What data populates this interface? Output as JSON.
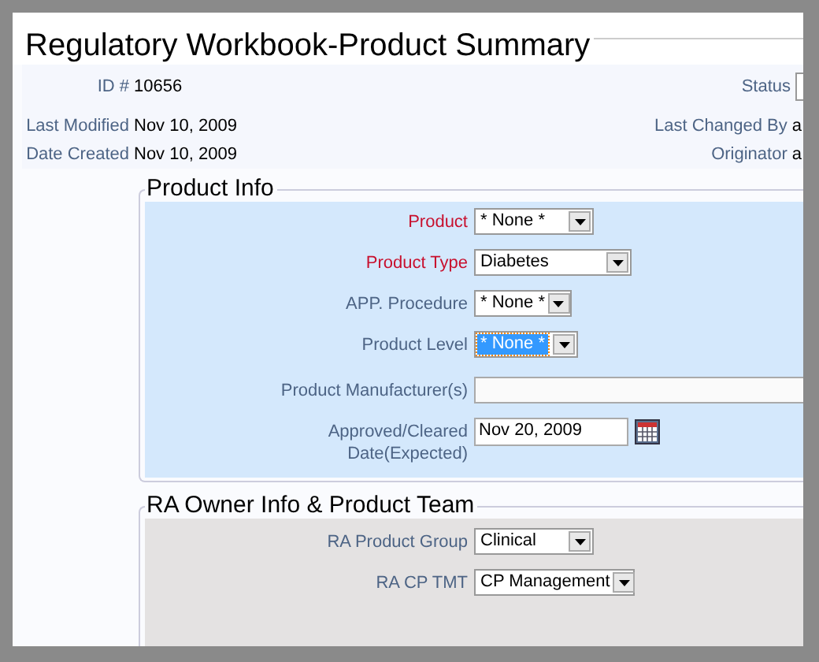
{
  "title": "Regulatory Workbook-Product Summary",
  "header": {
    "left": [
      {
        "label": "ID #",
        "value": "10656"
      },
      {
        "label": "Last Modified",
        "value": "Nov 10, 2009"
      },
      {
        "label": "Date Created",
        "value": "Nov 10, 2009"
      }
    ],
    "right": [
      {
        "label": "Status",
        "kind": "select"
      },
      {
        "label": "Last Changed By",
        "kind": "text",
        "value": "a"
      },
      {
        "label": "Originator",
        "kind": "text",
        "value": "a"
      }
    ]
  },
  "sections": [
    {
      "title": "Product Info",
      "color": "#d4e8fc",
      "fields": [
        {
          "label": "Product",
          "kind": "select",
          "value": "* None *",
          "required": true,
          "focused": false
        },
        {
          "label": "Product Type",
          "kind": "select",
          "value": "Diabetes",
          "required": true,
          "focused": false
        },
        {
          "label": "APP. Procedure",
          "kind": "select",
          "value": "* None *",
          "required": false,
          "focused": false
        },
        {
          "label": "Product Level",
          "kind": "select",
          "value": "* None *",
          "required": false,
          "focused": true
        },
        {
          "label": "Product Manufacturer(s)",
          "kind": "text",
          "required": false,
          "focused": false
        },
        {
          "label": "Approved/Cleared Date(Expected)",
          "kind": "date",
          "value": "Nov 20, 2009",
          "required": false,
          "focused": false
        }
      ]
    },
    {
      "title": "RA Owner Info & Product Team",
      "color": "#e4e2e2",
      "fields": [
        {
          "label": "RA Product Group",
          "kind": "select",
          "value": "Clinical",
          "required": false,
          "focused": false
        },
        {
          "label": "RA CP TMT",
          "kind": "select",
          "value": "CP Management",
          "required": false,
          "focused": false
        }
      ]
    }
  ]
}
